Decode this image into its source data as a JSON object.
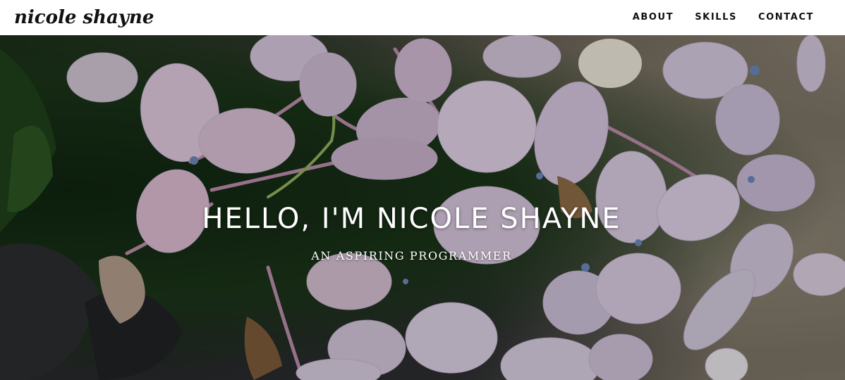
{
  "brand": {
    "name": "nicole shayne"
  },
  "nav": {
    "items": [
      {
        "label": "ABOUT"
      },
      {
        "label": "SKILLS"
      },
      {
        "label": "CONTACT"
      }
    ]
  },
  "hero": {
    "title": "HELLO, I'M NICOLE SHAYNE",
    "subtitle": "AN ASPIRING PROGRAMMER",
    "background_image": "hydrangea-flowers-photo"
  },
  "colors": {
    "navbar_bg": "#ffffff",
    "nav_text": "#111111",
    "hero_text": "#ffffff",
    "petal": "#d8c8e0",
    "petal_pink": "#e0b8cc",
    "foliage": "#1f3a1c"
  }
}
